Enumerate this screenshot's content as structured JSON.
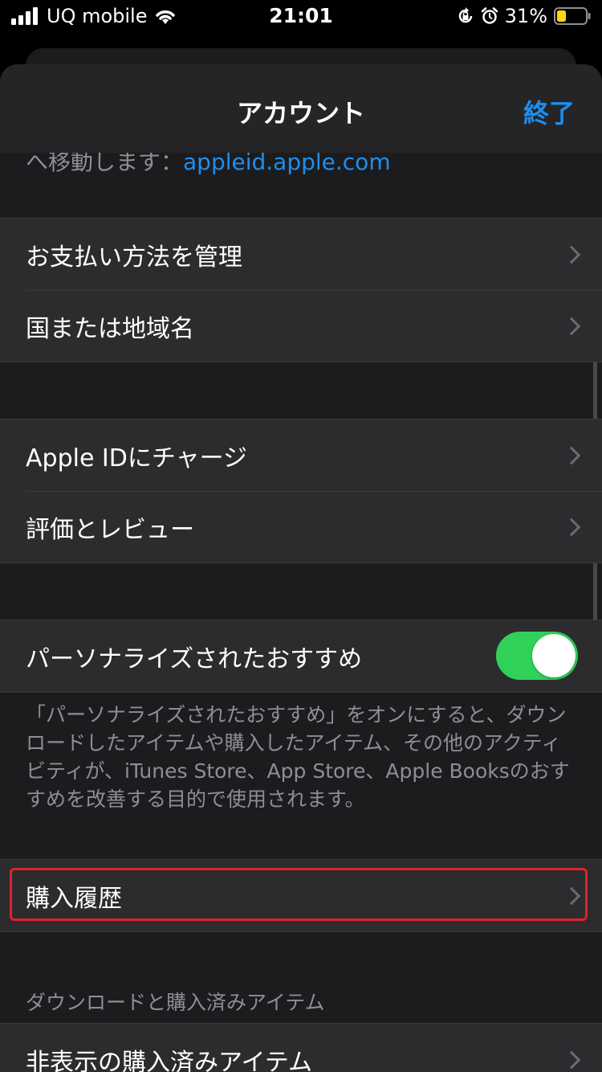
{
  "status_bar": {
    "carrier": "UQ mobile",
    "time": "21:01",
    "battery_percent": "31%"
  },
  "nav": {
    "title": "アカウント",
    "done_label": "終了"
  },
  "partial_text": {
    "prefix": "へ移動します：",
    "link": "appleid.apple.com"
  },
  "groups": {
    "payment": [
      "お支払い方法を管理",
      "国または地域名"
    ],
    "store": [
      "Apple IDにチャージ",
      "評価とレビュー"
    ],
    "personalize": {
      "label": "パーソナライズされたおすすめ",
      "toggle_on": true
    },
    "personalize_footnote": "「パーソナライズされたおすすめ」をオンにすると、ダウンロードしたアイテムや購入したアイテム、その他のアクティビティが、iTunes Store、App Store、Apple Booksのおすすめを改善する目的で使用されます。",
    "purchase_history": "購入履歴",
    "downloads_header": "ダウンロードと購入済みアイテム",
    "hidden_purchases": "非表示の購入済みアイテム"
  },
  "colors": {
    "accent": "#1e8ef0",
    "toggle_on": "#30d158",
    "highlight": "#e0222a"
  }
}
